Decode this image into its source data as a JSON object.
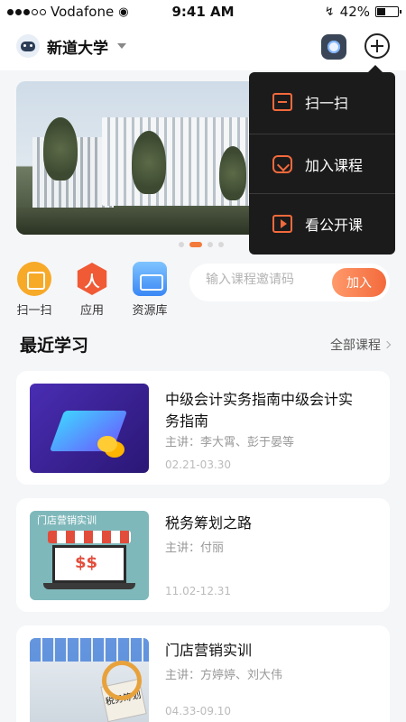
{
  "status_bar": {
    "carrier": "Vodafone",
    "time": "9:41 AM",
    "battery_percent": "42%",
    "battery_level": 0.42
  },
  "header": {
    "school_name": "新道大学",
    "icons": [
      "avatar-icon",
      "chevron-down-icon",
      "camera-robot-icon",
      "plus-circle-icon"
    ]
  },
  "dropdown_menu": {
    "items": [
      {
        "label": "扫一扫",
        "icon": "scan-icon"
      },
      {
        "label": "加入课程",
        "icon": "join-course-icon"
      },
      {
        "label": "看公开课",
        "icon": "play-video-icon"
      }
    ]
  },
  "banner": {
    "slide_count": 4,
    "active_slide": 2
  },
  "quick_actions": [
    {
      "label": "扫一扫",
      "icon": "scan-icon",
      "color": "#f7a928"
    },
    {
      "label": "应用",
      "icon": "app-icon",
      "color": "#f05a35"
    },
    {
      "label": "资源库",
      "icon": "library-icon",
      "color": "#3a87f5"
    }
  ],
  "invite": {
    "placeholder": "输入课程邀请码",
    "value": "",
    "button_label": "加入"
  },
  "recent": {
    "title": "最近学习",
    "more_label": "全部课程",
    "courses": [
      {
        "title": "中级会计实务指南中级会计实务指南",
        "teacher": "主讲：李大霄、彭于晏等",
        "dates": "02.21-03.30"
      },
      {
        "title": "税务筹划之路",
        "teacher": "主讲：付丽",
        "dates": "11.02-12.31",
        "thumb_caption": "门店营销实训"
      },
      {
        "title": "门店营销实训",
        "teacher": "主讲：方婷婷、刘大伟",
        "dates": "04.33-09.10",
        "thumb_caption": "税务筹划"
      }
    ]
  },
  "colors": {
    "accent": "#f36a3c",
    "menu_bg": "#1b1b1b",
    "page_bg": "#f5f6f8"
  }
}
